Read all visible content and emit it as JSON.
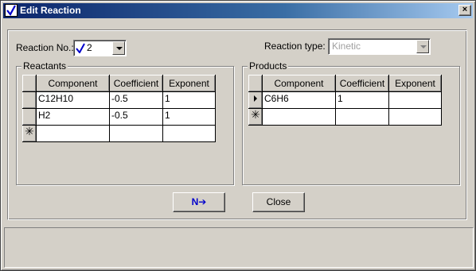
{
  "window": {
    "title": "Edit Reaction",
    "close_glyph": "×"
  },
  "reaction_no": {
    "label": "Reaction No.:",
    "value": "2"
  },
  "reaction_type": {
    "label": "Reaction type:",
    "value": "Kinetic"
  },
  "reactants": {
    "title": "Reactants",
    "columns": [
      "Component",
      "Coefficient",
      "Exponent"
    ],
    "rows": [
      {
        "component": "C12H10",
        "coefficient": "-0.5",
        "exponent": "1"
      },
      {
        "component": "H2",
        "coefficient": "-0.5",
        "exponent": "1"
      }
    ],
    "new_row_glyph": "✳"
  },
  "products": {
    "title": "Products",
    "columns": [
      "Component",
      "Coefficient",
      "Exponent"
    ],
    "rows": [
      {
        "component": "C6H6",
        "coefficient": "1",
        "exponent": ""
      }
    ],
    "new_row_glyph": "✳"
  },
  "buttons": {
    "next_label": "N➔",
    "close_label": "Close"
  },
  "colors": {
    "titlebar_start": "#0a246a",
    "next_text": "#0000cc",
    "face": "#d4d0c8"
  }
}
